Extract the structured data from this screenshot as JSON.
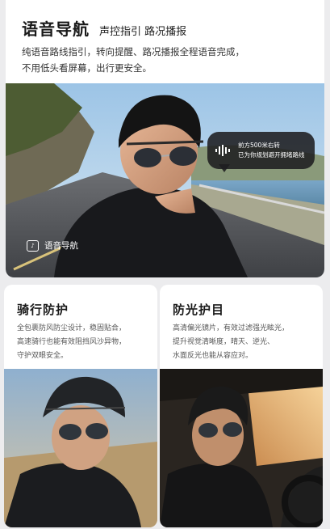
{
  "hero": {
    "title": "语音导航",
    "subtitle": "声控指引 路况播报",
    "desc_line1": "纯语音路线指引，转向提醒、路况播报全程语音完成，",
    "desc_line2": "不用低头看屏幕，出行更安全。",
    "bubble_line1": "前方500米右转",
    "bubble_line2": "已为你规划避开拥堵路线",
    "badge_label": "语音导航",
    "badge_icon": "voice-navigation-icon"
  },
  "cards": [
    {
      "title": "骑行防护",
      "desc_lines": [
        "全包裹防风防尘设计，稳固贴合，",
        "高速骑行也能有效阻挡风沙异物，",
        "守护双眼安全。"
      ]
    },
    {
      "title": "防光护目",
      "desc_lines": [
        "高清偏光镜片，有效过滤强光眩光，",
        "提升视觉清晰度，晴天、逆光、",
        "水面反光也能从容应对。"
      ]
    }
  ],
  "colors": {
    "background": "#ececee",
    "card": "#ffffff",
    "bubble": "#1e1e20",
    "text": "#1a1a1a"
  }
}
